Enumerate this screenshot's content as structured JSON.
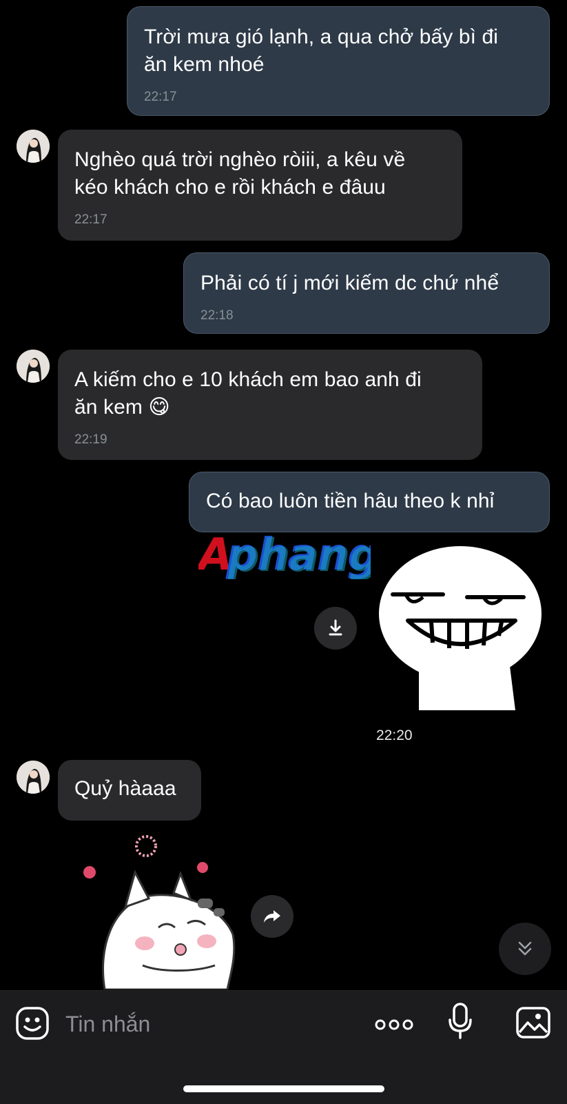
{
  "messages": [
    {
      "direction": "out",
      "text": "Trời mưa gió lạnh, a qua chở bấy bì đi\năn kem nhoé",
      "time": "22:17"
    },
    {
      "direction": "in",
      "text": "Nghèo quá trời nghèo ròiii, a kêu về\nkéo khách cho e rồi khách e đâuu",
      "time": "22:17"
    },
    {
      "direction": "out",
      "text": "Phải có tí j mới kiếm dc chứ nhể",
      "time": "22:18"
    },
    {
      "direction": "in",
      "text": "A kiếm cho e 10 khách em bao anh đi\năn kem",
      "emoji": "😋",
      "time": "22:19"
    },
    {
      "direction": "out",
      "text": "Có bao luôn tiền hâu theo k nhỉ"
    },
    {
      "direction": "out",
      "type": "sticker",
      "sticker": "smirking-grin-face-sticker",
      "time": "22:20"
    },
    {
      "direction": "in",
      "text": "Quỷ hàaaa"
    },
    {
      "direction": "in",
      "type": "sticker",
      "sticker": "cat-blushing-sticker"
    }
  ],
  "watermark": {
    "text": "Aphang",
    "color_a": "#d0101e",
    "color_b": "#1a4fd0",
    "color_c": "#1aa0b8"
  },
  "composer": {
    "placeholder": "Tin nhắn"
  },
  "icons": {
    "emoji": "emoji-icon",
    "more": "more-dots-icon",
    "mic": "microphone-icon",
    "gallery": "image-gallery-icon",
    "download": "download-icon",
    "forward": "forward-icon",
    "scroll_down": "chevron-double-down-icon"
  },
  "colors": {
    "outgoing_bubble": "#2e3a48",
    "incoming_bubble": "#2a2a2c",
    "background": "#000000",
    "composer": "#1c1c1e"
  }
}
